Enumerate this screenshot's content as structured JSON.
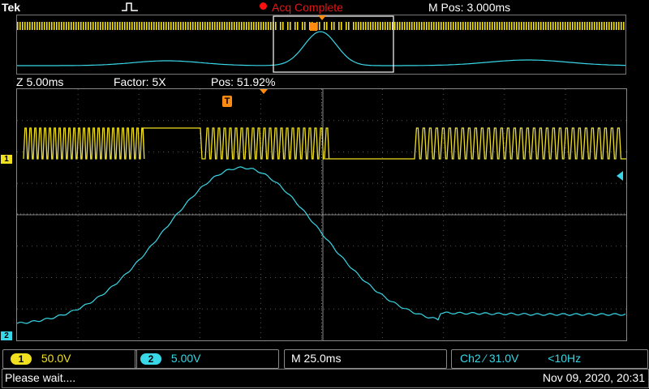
{
  "header": {
    "brand": "Tek",
    "acq_status": "Acq Complete",
    "m_pos": "M Pos: 3.000ms"
  },
  "zoom": {
    "z_scale": "Z 5.00ms",
    "factor": "Factor: 5X",
    "pos": "Pos: 51.92%"
  },
  "channels": {
    "ch1": {
      "number": "1",
      "scale": "50.0V",
      "color": "#f0e020"
    },
    "ch2": {
      "number": "2",
      "scale": "5.00V",
      "color": "#38d8e8"
    }
  },
  "timebase": "M 25.0ms",
  "trigger": {
    "source": "Ch2",
    "slope_symbol": "⁄",
    "level": "31.0V",
    "filter": "<10Hz"
  },
  "status": {
    "message": "Please wait....",
    "datetime": "Nov 09, 2020, 20:31"
  },
  "markers": {
    "trigger_glyph": "T"
  },
  "icons": {
    "trigger_type": "pulse-trigger-icon",
    "record_dot": "record-dot-icon",
    "trigger_position": "trigger-position-icon",
    "ch1_ground": "ch1-ground-marker-icon",
    "ch2_ground": "ch2-ground-marker-icon",
    "trigger_level": "trigger-level-arrow-icon"
  }
}
